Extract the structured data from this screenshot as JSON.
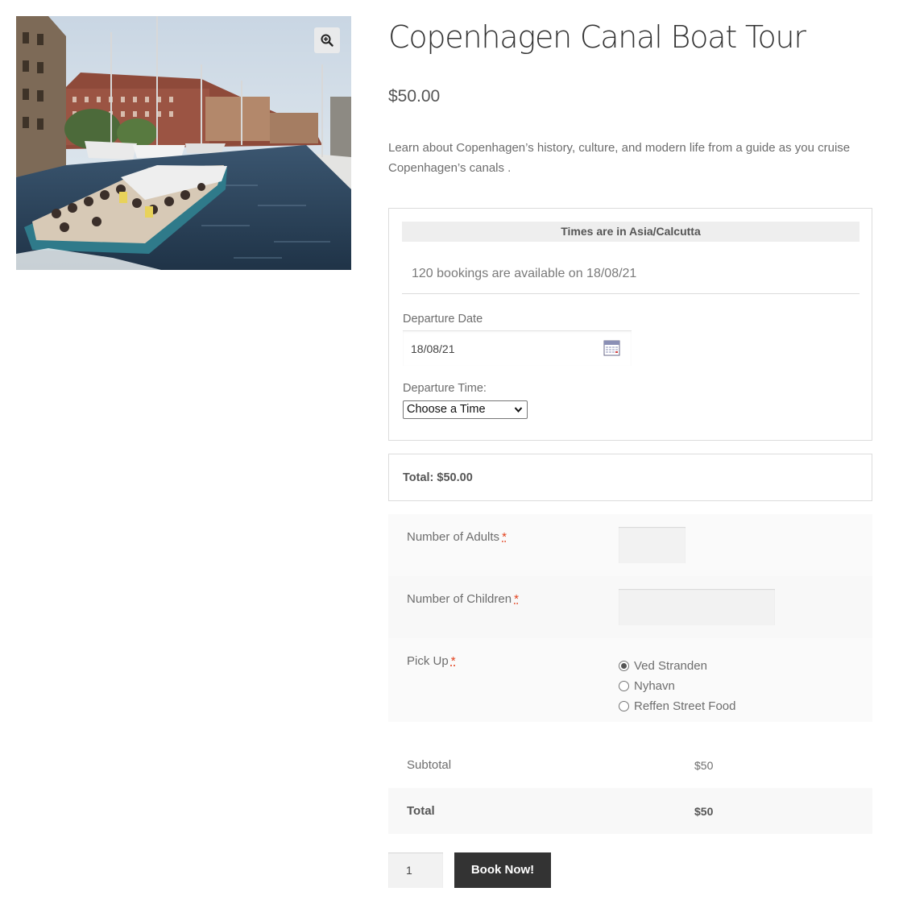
{
  "product": {
    "title": "Copenhagen Canal Boat Tour",
    "price": "$50.00",
    "description": "Learn about Copenhagen’s history, culture, and modern life from a guide as you cruise Copenhagen’s canals ."
  },
  "image": {
    "zoom_icon": "zoom-in-icon"
  },
  "booking": {
    "timezone_text": "Times are in Asia/Calcutta",
    "availability_text": "120 bookings are available on 18/08/21",
    "departure_date_label": "Departure Date",
    "departure_date_value": "18/08/21",
    "departure_time_label": "Departure Time:",
    "departure_time_selected": "Choose a Time",
    "total_text": "Total: $50.00"
  },
  "fields": {
    "adults_label": "Number of Adults",
    "children_label": "Number of Children",
    "pickup_label": "Pick Up",
    "required_mark": "*",
    "pickup_options": [
      "Ved Stranden",
      "Nyhavn",
      "Reffen Street Food"
    ],
    "pickup_selected": "Ved Stranden"
  },
  "totals": {
    "subtotal_label": "Subtotal",
    "subtotal_value": "$50",
    "total_label": "Total",
    "total_value": "$50"
  },
  "cart": {
    "quantity": "1",
    "book_button": "Book Now!"
  },
  "colors": {
    "button_bg": "#333333",
    "required": "#e2401c",
    "panel_bg": "#fafafa",
    "tz_bar_bg": "#eeeeee"
  }
}
